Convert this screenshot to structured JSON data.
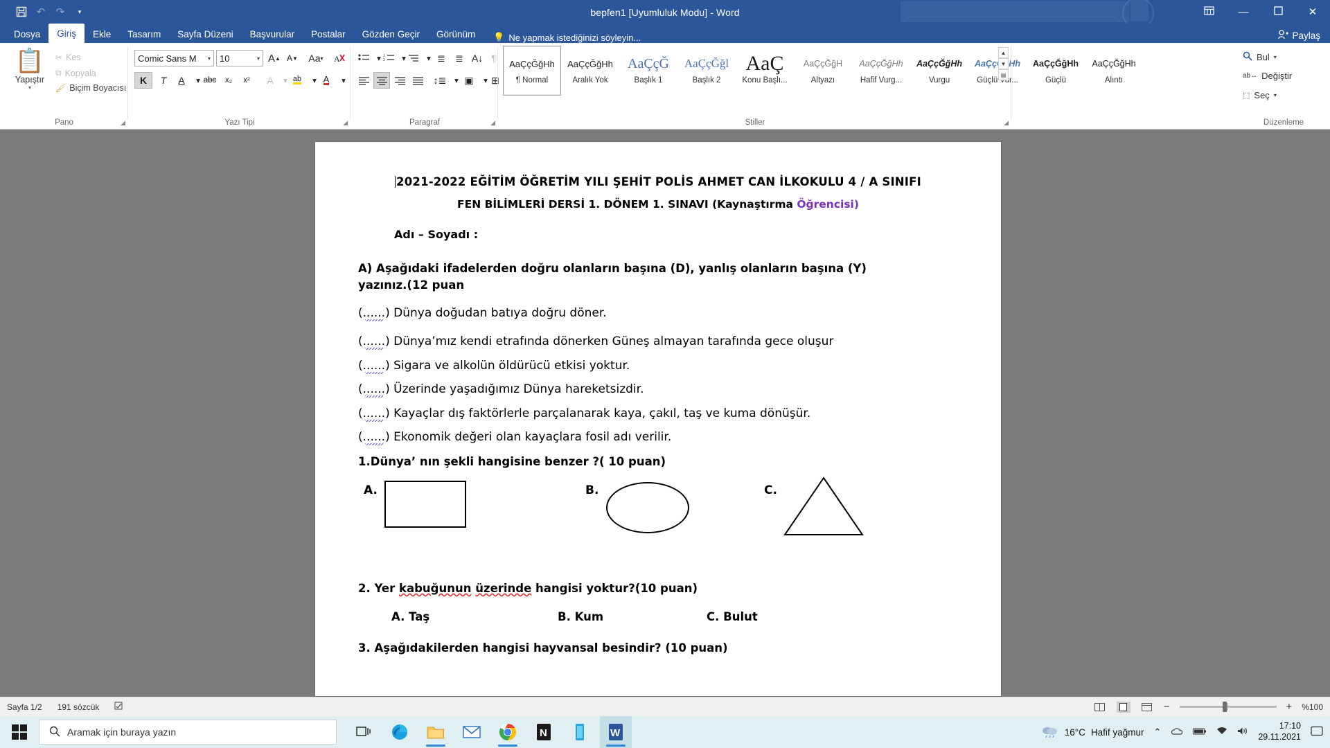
{
  "window": {
    "title": "bepfen1 [Uyumluluk Modu] - Word",
    "quick_access": [
      "save-icon",
      "undo-icon",
      "redo-icon",
      "customize-icon"
    ],
    "ribbon_display_label": "ribbon-display-icon",
    "minimize_label": "minimize-icon",
    "restore_label": "restore-icon",
    "close_label": "close-icon",
    "share_label": "Paylaş"
  },
  "tabs": [
    {
      "label": "Dosya",
      "active": false
    },
    {
      "label": "Giriş",
      "active": true
    },
    {
      "label": "Ekle",
      "active": false
    },
    {
      "label": "Tasarım",
      "active": false
    },
    {
      "label": "Sayfa Düzeni",
      "active": false
    },
    {
      "label": "Başvurular",
      "active": false
    },
    {
      "label": "Postalar",
      "active": false
    },
    {
      "label": "Gözden Geçir",
      "active": false
    },
    {
      "label": "Görünüm",
      "active": false
    }
  ],
  "tell_me": "Ne yapmak istediğinizi söyleyin...",
  "ribbon": {
    "groups": [
      {
        "name": "Pano"
      },
      {
        "name": "Yazı Tipi"
      },
      {
        "name": "Paragraf"
      },
      {
        "name": "Stiller"
      },
      {
        "name": "Düzenleme"
      }
    ],
    "clipboard": {
      "paste_label": "Yapıştır",
      "cut_label": "Kes",
      "copy_label": "Kopyala",
      "format_painter_label": "Biçim Boyacısı"
    },
    "font": {
      "font_name": "Comic Sans M",
      "font_size": "10",
      "grow_label": "A",
      "shrink_label": "A",
      "change_case_label": "Aa",
      "clear_format_label": "clear-formatting-icon",
      "bold_label": "K",
      "italic_label": "T",
      "underline_label": "A",
      "strikethrough_label": "abc",
      "subscript_label": "x₂",
      "superscript_label": "x²",
      "text_effects_label": "A",
      "highlight_label": "ab",
      "font_color_label": "A"
    },
    "editing": {
      "find_label": "Bul",
      "replace_label": "Değiştir",
      "select_label": "Seç"
    },
    "styles": [
      {
        "preview": "AaÇçĞğHh",
        "name": "¶ Normal",
        "selected": true,
        "style": "normal"
      },
      {
        "preview": "AaÇçĞğHh",
        "name": "Aralık Yok",
        "selected": false,
        "style": "normal"
      },
      {
        "preview": "AaÇçĞ",
        "name": "Başlık 1",
        "selected": false,
        "style": "h1"
      },
      {
        "preview": "AaÇçĞğl",
        "name": "Başlık 2",
        "selected": false,
        "style": "h2"
      },
      {
        "preview": "AaÇ",
        "name": "Konu Başlı...",
        "selected": false,
        "style": "title"
      },
      {
        "preview": "AaÇçĞğH",
        "name": "Altyazı",
        "selected": false,
        "style": "sub"
      },
      {
        "preview": "AaÇçĞğHh",
        "name": "Hafif Vurg...",
        "selected": false,
        "style": "italic"
      },
      {
        "preview": "AaÇçĞğHh",
        "name": "Vurgu",
        "selected": false,
        "style": "bolditalic"
      },
      {
        "preview": "AaÇçĞğHh",
        "name": "Güçlü Vur...",
        "selected": false,
        "style": "blueit"
      },
      {
        "preview": "AaÇçĞğHh",
        "name": "Güçlü",
        "selected": false,
        "style": "bold"
      },
      {
        "preview": "AaÇçĞğHh",
        "name": "Alıntı",
        "selected": false,
        "style": "normal"
      }
    ]
  },
  "document": {
    "heading1": "2021-2022 EĞİTİM ÖĞRETİM YILI ŞEHİT POLİS AHMET CAN İLKOKULU 4 / A SINIFI",
    "heading2_prefix": "FEN BİLİMLERİ DERSİ 1. DÖNEM 1. SINAVI (Kaynaştırma ",
    "heading2_colored": "Öğrencisi)",
    "heading2_color": "#7b2fbe",
    "name_line": "Adı – Soyadı  :",
    "section_a_line1": "A) Aşağıdaki ifadelerden doğru olanların başına (D), yanlış olanların başına (Y)",
    "section_a_line2": "yazınız.(12 puan",
    "blank_mark": "(......)",
    "true_false": [
      "Dünya doğudan batıya doğru döner.",
      "Dünya’mız  kendi  etrafında  dönerken  Güneş  almayan  tarafında  gece oluşur",
      "Sigara ve alkolün öldürücü etkisi yoktur.",
      "Üzerinde yaşadığımız Dünya hareketsizdir.",
      "Kayaçlar dış faktörlerle parçalanarak kaya, çakıl, taş ve kuma dönüşür.",
      "Ekonomik değeri olan kayaçlara fosil adı verilir."
    ],
    "q1": "1.Dünya’ nın şekli hangisine benzer ?( 10 puan)",
    "q1_options": [
      {
        "label": "A.",
        "shape": "rectangle"
      },
      {
        "label": "B.",
        "shape": "ellipse"
      },
      {
        "label": "C.",
        "shape": "triangle"
      }
    ],
    "q2": "2. Yer kabuğunun  üzerinde hangisi yoktur?(10 puan)",
    "q2_options": [
      {
        "label": "A.",
        "text": "Taş"
      },
      {
        "label": "B.",
        "text": "Kum"
      },
      {
        "label": "C.",
        "text": "Bulut"
      }
    ],
    "q3": "3. Aşağıdakilerden hangisi hayvansal besindir? (10 puan)"
  },
  "status_bar": {
    "page": "Sayfa 1/2",
    "words": "191 sözcük",
    "proofing_icon": "proofing-icon",
    "views": [
      "read-mode-icon",
      "print-layout-icon",
      "web-layout-icon"
    ],
    "zoom_out": "−",
    "zoom_in": "+",
    "zoom_level": "%100"
  },
  "taskbar": {
    "search_placeholder": "Aramak için buraya yazın",
    "apps": [
      {
        "name": "task-view-icon"
      },
      {
        "name": "edge-icon"
      },
      {
        "name": "file-explorer-icon"
      },
      {
        "name": "mail-icon"
      },
      {
        "name": "chrome-icon"
      },
      {
        "name": "onenote-icon"
      },
      {
        "name": "store-icon"
      },
      {
        "name": "word-icon"
      }
    ],
    "weather_temp": "16°C",
    "weather_text": "Hafif yağmur",
    "time": "17:10",
    "date": "29.11.2021"
  }
}
